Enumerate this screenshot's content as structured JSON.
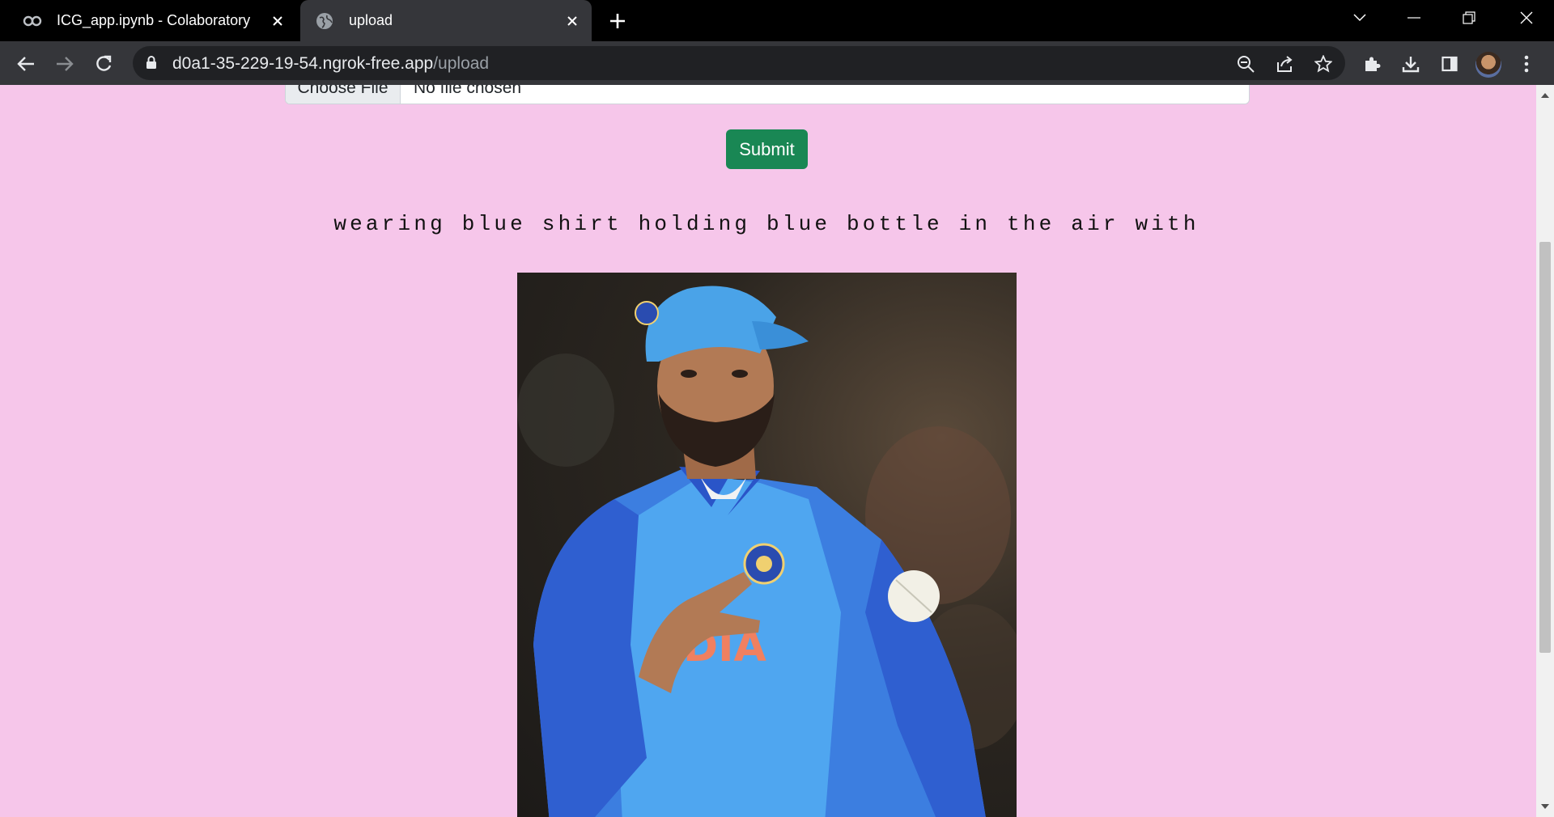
{
  "browser": {
    "tabs": [
      {
        "title": "ICG_app.ipynb - Colaboratory",
        "favicon": "colab-icon",
        "active": false
      },
      {
        "title": "upload",
        "favicon": "globe-icon",
        "active": true
      }
    ],
    "url_host": "d0a1-35-229-19-54.ngrok-free.app",
    "url_path": "/upload"
  },
  "page": {
    "file_input": {
      "button_label": "Choose File",
      "status": "No file chosen"
    },
    "submit_label": "Submit",
    "caption": "wearing blue shirt holding blue bottle in the air with",
    "image": {
      "description_icon": "uploaded-photo"
    }
  },
  "colors": {
    "page_bg": "#f6c6ea",
    "submit_bg": "#198754",
    "titlebar_bg": "#000000",
    "toolbar_bg": "#35363a"
  }
}
